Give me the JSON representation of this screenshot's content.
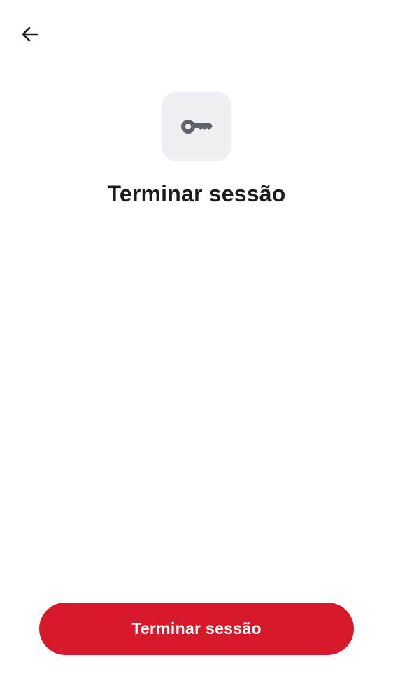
{
  "header": {
    "back_icon": "arrow-left-icon"
  },
  "hero": {
    "icon": "key-icon",
    "title": "Terminar sessão"
  },
  "actions": {
    "primary_label": "Terminar sessão"
  },
  "colors": {
    "accent": "#d71a2a",
    "icon_tile_bg": "#eff0f4",
    "icon_color": "#5f636b",
    "title_color": "#1a1a1f"
  }
}
